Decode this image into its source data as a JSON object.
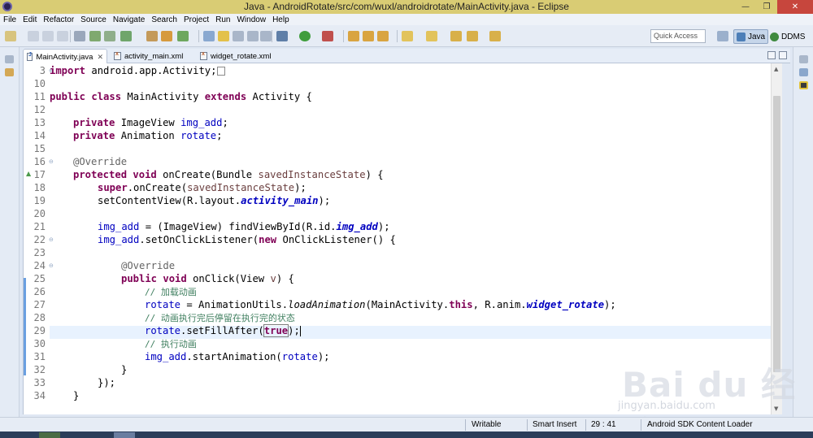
{
  "window": {
    "title": "Java - AndroidRotate/src/com/wuxl/androidrotate/MainActivity.java - Eclipse"
  },
  "menu": [
    "File",
    "Edit",
    "Refactor",
    "Source",
    "Navigate",
    "Search",
    "Project",
    "Run",
    "Window",
    "Help"
  ],
  "toolbar": {
    "quick_access": "Quick Access",
    "perspectives": [
      {
        "label": "Java",
        "active": true
      },
      {
        "label": "DDMS",
        "active": false
      }
    ]
  },
  "tabs": [
    {
      "label": "MainActivity.java",
      "type": "java",
      "active": true,
      "closeable": true
    },
    {
      "label": "activity_main.xml",
      "type": "xml",
      "active": false,
      "closeable": false
    },
    {
      "label": "widget_rotate.xml",
      "type": "xml",
      "active": false,
      "closeable": false
    }
  ],
  "gutter": {
    "lines": [
      "3",
      "10",
      "11",
      "12",
      "13",
      "14",
      "15",
      "16",
      "17",
      "18",
      "19",
      "20",
      "21",
      "22",
      "23",
      "24",
      "25",
      "26",
      "27",
      "28",
      "29",
      "30",
      "31",
      "32",
      "33",
      "34"
    ]
  },
  "code": {
    "import_kw": "import",
    "import_rest": " android.app.Activity;",
    "l11_a": "public",
    "l11_b": "class",
    "l11_c": " MainActivity ",
    "l11_d": "extends",
    "l11_e": " Activity {",
    "private": "private",
    "type_imageview": " ImageView ",
    "field_img_add": "img_add",
    "type_animation": " Animation ",
    "field_rotate": "rotate",
    "semi": ";",
    "override": "@Override",
    "protected": "protected",
    "void": "void",
    "oncreate_sig_a": " onCreate(Bundle ",
    "param_state": "savedInstanceState",
    "oncreate_sig_b": ") {",
    "super": "super",
    "super_call_a": ".onCreate(",
    "close_semi": ");",
    "setcontent_a": "setContentView(R.layout.",
    "sfield_activity_main": "activity_main",
    "assign_img_a": " = (ImageView) findViewById(R.id.",
    "sfield_img_add": "img_add",
    "setonclick_a": ".setOnClickListener(",
    "new": "new",
    "setonclick_b": " OnClickListener() {",
    "public": "public",
    "onclick_sig_a": " onClick(View ",
    "param_v": "v",
    "onclick_sig_b": ") {",
    "comment1": "// 加载动画",
    "load_a": " = AnimationUtils.",
    "load_method": "loadAnimation",
    "load_b": "(MainActivity.",
    "this": "this",
    "load_c": ", R.anim.",
    "sfield_widget_rotate": "widget_rotate",
    "comment2": "// 动画执行完后停留在执行完的状态",
    "fill_a": ".setFillAfter(",
    "true": "true",
    "comment3": "// 执行动画",
    "start_a": ".startAnimation(",
    "close_brace": "}",
    "close_anon": "});"
  },
  "status": {
    "writable": "Writable",
    "insert_mode": "Smart Insert",
    "position": "29 : 41",
    "task": "Android SDK Content Loader"
  },
  "watermark": {
    "logo": "Bai du 经验",
    "url": "jingyan.baidu.com"
  }
}
